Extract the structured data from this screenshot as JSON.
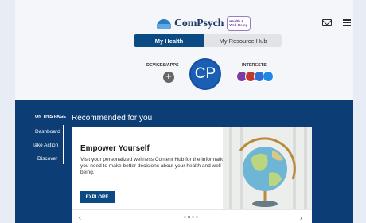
{
  "header": {
    "logo_text": "ComPsych",
    "badge_text": "Health & Well-Being"
  },
  "tabs": [
    {
      "label": "My Health",
      "active": true
    },
    {
      "label": "My Resource Hub",
      "active": false
    }
  ],
  "profile": {
    "devices_label": "DEVICES/APPS",
    "add_symbol": "+",
    "avatar_initials": "CP",
    "interests_label_prefix": "INTER",
    "interests_label_highlight": "E",
    "interests_label_suffix": "STS",
    "interest_colors": [
      "#7c3ba3",
      "#c0392b",
      "#2e6fd3",
      "#1e88e5"
    ]
  },
  "sidebar": {
    "heading": "ON THIS PAGE",
    "items": [
      {
        "label": "Dashboard"
      },
      {
        "label": "Take Action"
      },
      {
        "label": "Discover"
      }
    ]
  },
  "recommended": {
    "title": "Recommended for you",
    "card": {
      "title": "Empower Yourself",
      "text": "Visit your personalized wellness Content Hub for the information you need to make better decisions about your health and well-being.",
      "button_label": "EXPLORE"
    },
    "carousel": {
      "prev": "‹",
      "next": "›",
      "active_index": 1,
      "dot_count": 4
    }
  },
  "colors": {
    "primary": "#0b4a82",
    "dark_section": "#0c3e75",
    "avatar": "#1a5fb4"
  },
  "icons": {
    "mail": "mail-icon",
    "menu": "hamburger-menu-icon",
    "globe": "globe-icon"
  }
}
